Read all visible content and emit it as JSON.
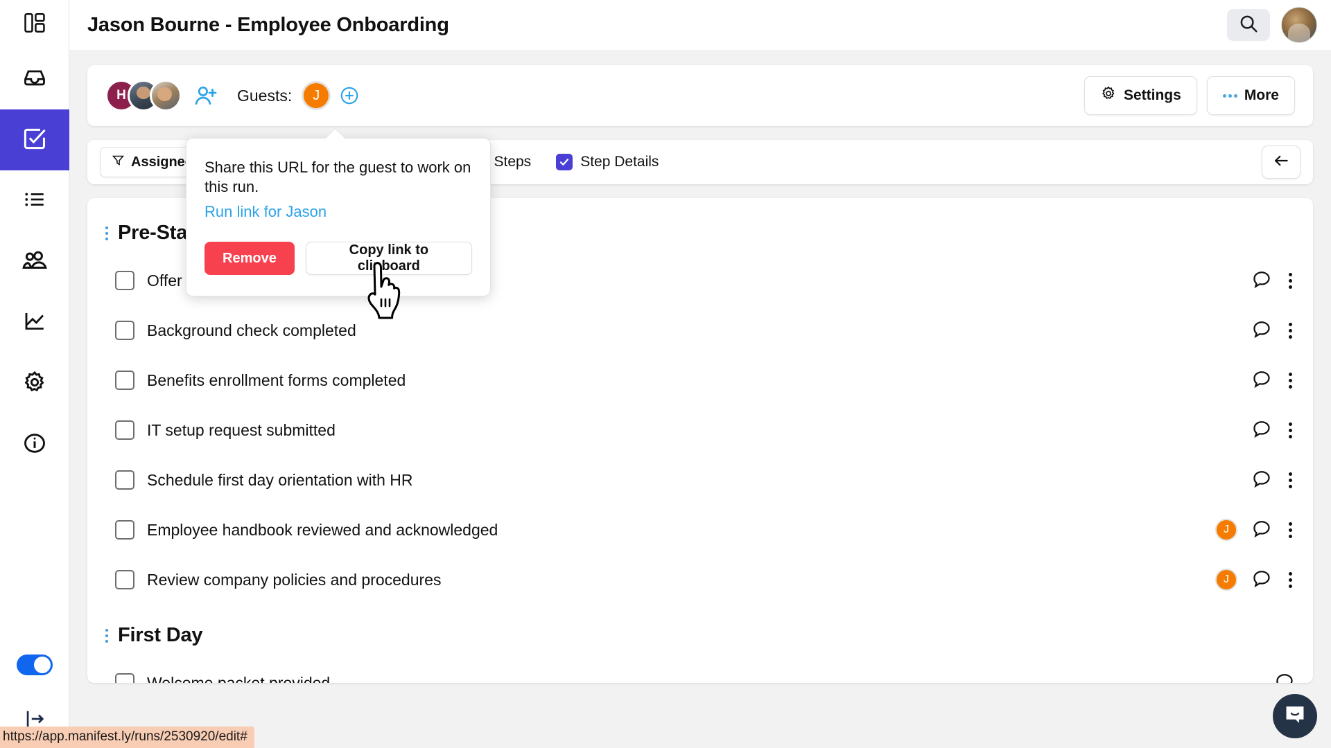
{
  "header": {
    "title": "Jason Bourne - Employee Onboarding",
    "search_icon": "search-icon",
    "avatar_alt": "user-avatar"
  },
  "sidebar": {
    "items": [
      {
        "icon": "layout-dashboard-icon",
        "name": "dashboard"
      },
      {
        "icon": "inbox-icon",
        "name": "inbox"
      },
      {
        "icon": "checkbox-icon",
        "name": "checklists",
        "active": true
      },
      {
        "icon": "list-icon",
        "name": "lists"
      },
      {
        "icon": "people-icon",
        "name": "people"
      },
      {
        "icon": "chart-line-icon",
        "name": "reports"
      },
      {
        "icon": "gear-icon",
        "name": "settings"
      },
      {
        "icon": "info-circle-icon",
        "name": "info"
      }
    ],
    "toggle_on": true,
    "logout_icon": "logout-icon"
  },
  "guest_bar": {
    "members": [
      {
        "initial": "H",
        "type": "initial"
      },
      {
        "initial": "",
        "type": "photo"
      },
      {
        "initial": "",
        "type": "photo"
      }
    ],
    "add_person_icon": "add-person-icon",
    "guests_label": "Guests:",
    "guest_initial": "J",
    "add_guest_icon": "plus-circle-icon",
    "settings_label": "Settings",
    "more_label": "More"
  },
  "filter_bar": {
    "assignee_label": "Assignee",
    "hidden_option_label": "Steps",
    "only_my_steps_label": "Only My Steps",
    "only_my_steps_checked": false,
    "step_details_label": "Step Details",
    "step_details_checked": true,
    "back_icon": "arrow-left-icon"
  },
  "popover": {
    "body": "Share this URL for the guest to work on this run.",
    "link_label": "Run link for Jason",
    "remove_label": "Remove",
    "copy_label": "Copy link to clipboard"
  },
  "groups": [
    {
      "title": "Pre-Start",
      "tasks": [
        {
          "label": "Offer letter signed and returned",
          "checked": false,
          "assignee": null
        },
        {
          "label": "Background check completed",
          "checked": false,
          "assignee": null
        },
        {
          "label": "Benefits enrollment forms completed",
          "checked": false,
          "assignee": null
        },
        {
          "label": "IT setup request submitted",
          "checked": false,
          "assignee": null
        },
        {
          "label": "Schedule first day orientation with HR",
          "checked": false,
          "assignee": null
        },
        {
          "label": "Employee handbook reviewed and acknowledged",
          "checked": false,
          "assignee": "J"
        },
        {
          "label": "Review company policies and procedures",
          "checked": false,
          "assignee": "J"
        }
      ]
    },
    {
      "title": "First Day",
      "tasks": [
        {
          "label": "Welcome packet provided",
          "checked": false,
          "assignee": null
        }
      ]
    }
  ],
  "status_bar": {
    "url": "https://app.manifest.ly/runs/2530920/edit#"
  },
  "chat": {
    "icon": "chat-bubble-icon"
  },
  "colors": {
    "accent_purple": "#4a3fd4",
    "guest_orange": "#f57c00",
    "link_blue": "#2aa3e8",
    "danger_red": "#f8414f",
    "toggle_blue": "#1166f0"
  }
}
